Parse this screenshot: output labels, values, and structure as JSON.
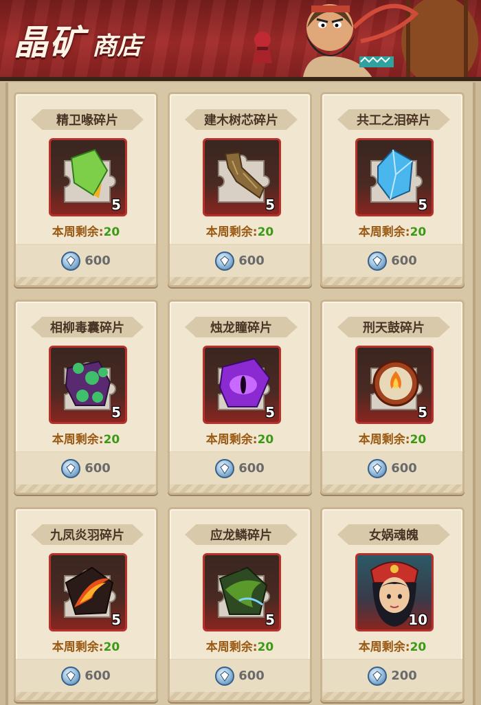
{
  "header": {
    "title_big": "晶矿",
    "title_small": "商店"
  },
  "items": [
    {
      "name": "精卫喙碎片",
      "weekly_label": "本周剩余:",
      "weekly_value": "20",
      "count": "5",
      "price": "600",
      "art": "green-crystal-puzzle"
    },
    {
      "name": "建木树芯碎片",
      "weekly_label": "本周剩余:",
      "weekly_value": "20",
      "count": "5",
      "price": "600",
      "art": "wood-branch-puzzle"
    },
    {
      "name": "共工之泪碎片",
      "weekly_label": "本周剩余:",
      "weekly_value": "20",
      "count": "5",
      "price": "600",
      "art": "blue-crystal-puzzle"
    },
    {
      "name": "相柳毒囊碎片",
      "weekly_label": "本周剩余:",
      "weekly_value": "20",
      "count": "5",
      "price": "600",
      "art": "poison-sac-puzzle"
    },
    {
      "name": "烛龙瞳碎片",
      "weekly_label": "本周剩余:",
      "weekly_value": "20",
      "count": "5",
      "price": "600",
      "art": "dragon-eye-puzzle"
    },
    {
      "name": "刑天鼓碎片",
      "weekly_label": "本周剩余:",
      "weekly_value": "20",
      "count": "5",
      "price": "600",
      "art": "flame-drum-puzzle"
    },
    {
      "name": "九凤炎羽碎片",
      "weekly_label": "本周剩余:",
      "weekly_value": "20",
      "count": "5",
      "price": "600",
      "art": "flame-feather-puzzle"
    },
    {
      "name": "应龙鳞碎片",
      "weekly_label": "本周剩余:",
      "weekly_value": "20",
      "count": "5",
      "price": "600",
      "art": "dragon-scale-puzzle"
    },
    {
      "name": "女娲魂魄",
      "weekly_label": "本周剩余:",
      "weekly_value": "20",
      "count": "10",
      "price": "200",
      "art": "nuwa-portrait"
    }
  ],
  "colors": {
    "weekly_label": "#9a5a14",
    "weekly_value": "#3a9a16",
    "frame_border": "#b8302c",
    "header_red": "#a32c2a"
  }
}
